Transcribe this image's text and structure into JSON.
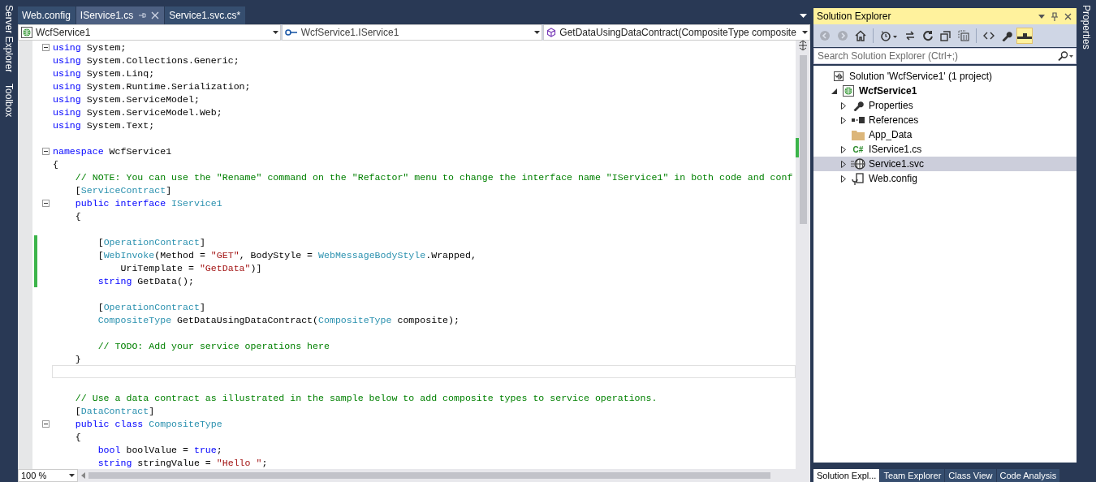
{
  "left_strip": [
    "Server Explorer",
    "Toolbox"
  ],
  "tabs": [
    {
      "label": "Web.config",
      "selected": false
    },
    {
      "label": "IService1.cs",
      "selected": true
    },
    {
      "label": "Service1.svc.cs*",
      "selected": false
    }
  ],
  "nav_bar": [
    {
      "kind": "project",
      "text": "WcfService1"
    },
    {
      "kind": "type",
      "text": "WcfService1.IService1"
    },
    {
      "kind": "member",
      "text": "GetDataUsingDataContract(CompositeType composite"
    }
  ],
  "editor": {
    "lines": [
      {
        "fold": true,
        "changed": false,
        "current": false,
        "segments": [
          {
            "kind": "keyword",
            "text": "using"
          },
          {
            "kind": "plain",
            "text": " System;"
          }
        ]
      },
      {
        "fold": false,
        "changed": false,
        "current": false,
        "segments": [
          {
            "kind": "keyword",
            "text": "using"
          },
          {
            "kind": "plain",
            "text": " System.Collections.Generic;"
          }
        ]
      },
      {
        "fold": false,
        "changed": false,
        "current": false,
        "segments": [
          {
            "kind": "keyword",
            "text": "using"
          },
          {
            "kind": "plain",
            "text": " System.Linq;"
          }
        ]
      },
      {
        "fold": false,
        "changed": false,
        "current": false,
        "segments": [
          {
            "kind": "keyword",
            "text": "using"
          },
          {
            "kind": "plain",
            "text": " System.Runtime.Serialization;"
          }
        ]
      },
      {
        "fold": false,
        "changed": false,
        "current": false,
        "segments": [
          {
            "kind": "keyword",
            "text": "using"
          },
          {
            "kind": "plain",
            "text": " System.ServiceModel;"
          }
        ]
      },
      {
        "fold": false,
        "changed": false,
        "current": false,
        "segments": [
          {
            "kind": "keyword",
            "text": "using"
          },
          {
            "kind": "plain",
            "text": " System.ServiceModel.Web;"
          }
        ]
      },
      {
        "fold": false,
        "changed": false,
        "current": false,
        "segments": [
          {
            "kind": "keyword",
            "text": "using"
          },
          {
            "kind": "plain",
            "text": " System.Text;"
          }
        ]
      },
      {
        "fold": false,
        "changed": false,
        "current": false
      },
      {
        "fold": true,
        "changed": false,
        "current": false,
        "segments": [
          {
            "kind": "keyword",
            "text": "namespace"
          },
          {
            "kind": "plain",
            "text": " WcfService1"
          }
        ]
      },
      {
        "fold": false,
        "changed": false,
        "current": false,
        "segments": [
          {
            "kind": "plain",
            "text": "{"
          }
        ]
      },
      {
        "fold": false,
        "changed": false,
        "current": false,
        "segments": [
          {
            "kind": "comment",
            "text": "    // NOTE: You can use the \"Rename\" command on the \"Refactor\" menu to change the interface name \"IService1\" in both code and conf"
          }
        ]
      },
      {
        "fold": false,
        "changed": false,
        "current": false,
        "segments": [
          {
            "kind": "plain",
            "text": "    ["
          },
          {
            "kind": "type",
            "text": "ServiceContract"
          },
          {
            "kind": "plain",
            "text": "]"
          }
        ]
      },
      {
        "fold": true,
        "changed": false,
        "current": false,
        "segments": [
          {
            "kind": "keyword",
            "text": "    public"
          },
          {
            "kind": "keyword",
            "text": " interface"
          },
          {
            "kind": "type",
            "text": " IService1"
          }
        ]
      },
      {
        "fold": false,
        "changed": false,
        "current": false,
        "segments": [
          {
            "kind": "plain",
            "text": "    {"
          }
        ]
      },
      {
        "fold": false,
        "changed": false,
        "current": false
      },
      {
        "fold": false,
        "changed": true,
        "current": false,
        "segments": [
          {
            "kind": "plain",
            "text": "        ["
          },
          {
            "kind": "type",
            "text": "OperationContract"
          },
          {
            "kind": "plain",
            "text": "]"
          }
        ]
      },
      {
        "fold": false,
        "changed": true,
        "current": false,
        "segments": [
          {
            "kind": "plain",
            "text": "        ["
          },
          {
            "kind": "type",
            "text": "WebInvoke"
          },
          {
            "kind": "plain",
            "text": "(Method = "
          },
          {
            "kind": "string",
            "text": "\"GET\""
          },
          {
            "kind": "plain",
            "text": ", BodyStyle = "
          },
          {
            "kind": "type",
            "text": "WebMessageBodyStyle"
          },
          {
            "kind": "plain",
            "text": ".Wrapped,"
          }
        ]
      },
      {
        "fold": false,
        "changed": true,
        "current": false,
        "segments": [
          {
            "kind": "plain",
            "text": "            UriTemplate = "
          },
          {
            "kind": "string",
            "text": "\"GetData\""
          },
          {
            "kind": "plain",
            "text": ")]"
          }
        ]
      },
      {
        "fold": false,
        "changed": true,
        "current": false,
        "segments": [
          {
            "kind": "keyword",
            "text": "        string"
          },
          {
            "kind": "plain",
            "text": " GetData();"
          }
        ]
      },
      {
        "fold": false,
        "changed": false,
        "current": false
      },
      {
        "fold": false,
        "changed": false,
        "current": false,
        "segments": [
          {
            "kind": "plain",
            "text": "        ["
          },
          {
            "kind": "type",
            "text": "OperationContract"
          },
          {
            "kind": "plain",
            "text": "]"
          }
        ]
      },
      {
        "fold": false,
        "changed": false,
        "current": false,
        "segments": [
          {
            "kind": "type",
            "text": "        CompositeType"
          },
          {
            "kind": "plain",
            "text": " GetDataUsingDataContract("
          },
          {
            "kind": "type",
            "text": "CompositeType"
          },
          {
            "kind": "plain",
            "text": " composite);"
          }
        ]
      },
      {
        "fold": false,
        "changed": false,
        "current": false
      },
      {
        "fold": false,
        "changed": false,
        "current": false,
        "segments": [
          {
            "kind": "comment",
            "text": "        // TODO: Add your service operations here"
          }
        ]
      },
      {
        "fold": false,
        "changed": false,
        "current": false,
        "segments": [
          {
            "kind": "plain",
            "text": "    }"
          }
        ]
      },
      {
        "fold": false,
        "changed": false,
        "current": true
      },
      {
        "fold": false,
        "changed": false,
        "current": false
      },
      {
        "fold": false,
        "changed": false,
        "current": false,
        "segments": [
          {
            "kind": "comment",
            "text": "    // Use a data contract as illustrated in the sample below to add composite types to service operations."
          }
        ]
      },
      {
        "fold": false,
        "changed": false,
        "current": false,
        "segments": [
          {
            "kind": "plain",
            "text": "    ["
          },
          {
            "kind": "type",
            "text": "DataContract"
          },
          {
            "kind": "plain",
            "text": "]"
          }
        ]
      },
      {
        "fold": true,
        "changed": false,
        "current": false,
        "segments": [
          {
            "kind": "keyword",
            "text": "    public"
          },
          {
            "kind": "keyword",
            "text": " class"
          },
          {
            "kind": "type",
            "text": " CompositeType"
          }
        ]
      },
      {
        "fold": false,
        "changed": false,
        "current": false,
        "segments": [
          {
            "kind": "plain",
            "text": "    {"
          }
        ]
      },
      {
        "fold": false,
        "changed": false,
        "current": false,
        "segments": [
          {
            "kind": "keyword",
            "text": "        bool"
          },
          {
            "kind": "plain",
            "text": " boolValue = "
          },
          {
            "kind": "keyword",
            "text": "true"
          },
          {
            "kind": "plain",
            "text": ";"
          }
        ]
      },
      {
        "fold": false,
        "changed": false,
        "current": false,
        "segments": [
          {
            "kind": "keyword",
            "text": "        string"
          },
          {
            "kind": "plain",
            "text": " stringValue = "
          },
          {
            "kind": "string",
            "text": "\"Hello \""
          },
          {
            "kind": "plain",
            "text": ";"
          }
        ]
      }
    ]
  },
  "zoom": "100 %",
  "solution_explorer": {
    "title": "Solution Explorer",
    "toolbar": [
      {
        "kind": "back",
        "disabled": true,
        "pressed": false
      },
      {
        "kind": "forward",
        "disabled": true,
        "pressed": false
      },
      {
        "kind": "home",
        "disabled": false,
        "pressed": false
      },
      {
        "kind": "pending",
        "disabled": false,
        "pressed": false
      },
      {
        "kind": "sync",
        "disabled": false,
        "pressed": false
      },
      {
        "kind": "refresh",
        "disabled": false,
        "pressed": false
      },
      {
        "kind": "collapse",
        "disabled": false,
        "pressed": false
      },
      {
        "kind": "showall",
        "disabled": false,
        "pressed": false
      },
      {
        "kind": "code",
        "disabled": false,
        "pressed": false
      },
      {
        "kind": "properties",
        "disabled": false,
        "pressed": false
      },
      {
        "kind": "preview",
        "disabled": false,
        "pressed": true
      }
    ],
    "search": {
      "placeholder": "Search Solution Explorer (Ctrl+;)"
    },
    "tree": [
      {
        "kind": "solution",
        "label": "Solution 'WcfService1' (1 project)",
        "selected": false,
        "children": [
          {
            "kind": "project",
            "label": "WcfService1",
            "selected": false,
            "expanded": true,
            "children": [
              {
                "kind": "properties",
                "label": "Properties",
                "selected": false,
                "expanded": false
              },
              {
                "kind": "references",
                "label": "References",
                "selected": false,
                "expanded": false
              },
              {
                "kind": "folder",
                "label": "App_Data",
                "selected": false
              },
              {
                "kind": "csharp",
                "icon_text": "C#",
                "label": "IService1.cs",
                "selected": false,
                "expanded": false
              },
              {
                "kind": "service",
                "label": "Service1.svc",
                "selected": true,
                "expanded": false
              },
              {
                "kind": "config",
                "label": "Web.config",
                "selected": false,
                "expanded": false
              }
            ]
          }
        ]
      }
    ]
  },
  "bottom_tabs": [
    {
      "label": "Solution Expl...",
      "selected": true
    },
    {
      "label": "Team Explorer",
      "selected": false
    },
    {
      "label": "Class View",
      "selected": false
    },
    {
      "label": "Code Analysis",
      "selected": false
    }
  ],
  "right_strip": [
    "Properties"
  ]
}
